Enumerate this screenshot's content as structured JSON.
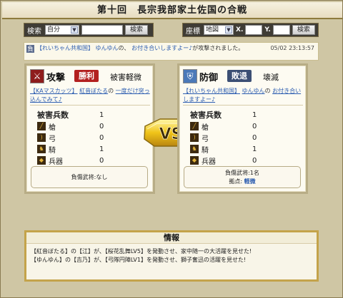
{
  "page": {
    "title": "第十回　長宗我部家土佐国の合戦"
  },
  "search_bar": {
    "label": "検索",
    "select_value": "自分",
    "button_label": "検索"
  },
  "coord_bar": {
    "label": "座標",
    "select_value": "地図",
    "x_label": "X.",
    "y_label": "Y.",
    "button_label": "検索"
  },
  "notice": {
    "badge": "負",
    "alliance": "【れいちゃん共和国】",
    "user": "ゆんゆん",
    "text_1": "の、",
    "link": "お付き合いしますよー♪",
    "text_2": "が攻撃されました。",
    "timestamp": "05/02 23:13:57"
  },
  "attacker": {
    "role": "攻撃",
    "result": "勝利",
    "damage": "被害軽微",
    "alliance": "【KAマスカッツ】",
    "user": "紅音ぼたる",
    "text": "の",
    "link": "一度だけ突っ込んでみて♪",
    "rows": [
      {
        "label": "被害兵数",
        "value": "1"
      },
      {
        "label": "槍",
        "value": "0"
      },
      {
        "label": "弓",
        "value": "0"
      },
      {
        "label": "騎",
        "value": "1"
      },
      {
        "label": "兵器",
        "value": "0"
      }
    ],
    "wounded_label": "負傷武将:なし"
  },
  "defender": {
    "role": "防御",
    "result": "敗退",
    "damage": "壊滅",
    "alliance": "【れいちゃん共和国】",
    "user": "ゆんゆん",
    "text": "の",
    "link": "お付き合いしますよー♪",
    "rows": [
      {
        "label": "被害兵数",
        "value": "1"
      },
      {
        "label": "槍",
        "value": "0"
      },
      {
        "label": "弓",
        "value": "0"
      },
      {
        "label": "騎",
        "value": "1"
      },
      {
        "label": "兵器",
        "value": "0"
      }
    ],
    "wounded_label": "負傷武将:1名",
    "base_label": "拠点:",
    "base_status": "軽微"
  },
  "vs_label": "VS",
  "info": {
    "title": "情報",
    "line_1": "【紅音ぼたる】の【江】が、【桜花乱舞LV5】を発動させ、家中随一の大活躍を見せた!",
    "line_2": "【ゆんゆん】の【吉乃】が、【弓隊円陣LV1】を発動させ、獅子奮迅の活躍を見せた!"
  },
  "colors": {
    "accent_red": "#b32020",
    "accent_navy": "#3c4f74",
    "gold": "#c4a34a"
  }
}
